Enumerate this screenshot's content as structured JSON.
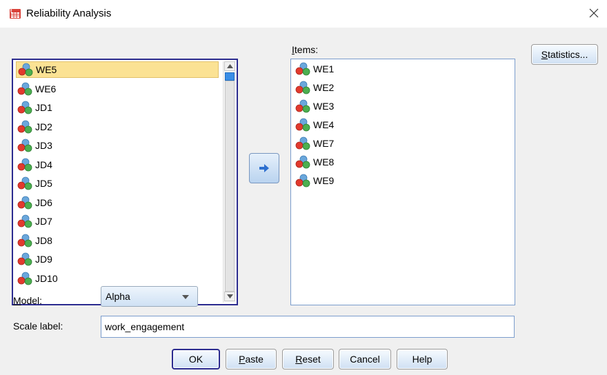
{
  "window": {
    "title": "Reliability Analysis",
    "close_glyph": "×"
  },
  "source_list": {
    "items": [
      {
        "label": "WE5",
        "icon": "scale-variable-icon",
        "selected": true
      },
      {
        "label": "WE6",
        "icon": "scale-variable-icon"
      },
      {
        "label": "JD1",
        "icon": "scale-variable-icon"
      },
      {
        "label": "JD2",
        "icon": "scale-variable-icon"
      },
      {
        "label": "JD3",
        "icon": "scale-variable-icon"
      },
      {
        "label": "JD4",
        "icon": "scale-variable-icon"
      },
      {
        "label": "JD5",
        "icon": "scale-variable-icon"
      },
      {
        "label": "JD6",
        "icon": "scale-variable-icon"
      },
      {
        "label": "JD7",
        "icon": "scale-variable-icon"
      },
      {
        "label": "JD8",
        "icon": "scale-variable-icon"
      },
      {
        "label": "JD9",
        "icon": "scale-variable-icon"
      },
      {
        "label": "JD10",
        "icon": "scale-variable-icon"
      }
    ]
  },
  "items_panel": {
    "label_prefix": "",
    "label_mnemonic": "I",
    "label_rest": "tems:",
    "items": [
      {
        "label": "WE1",
        "icon": "scale-variable-icon"
      },
      {
        "label": "WE2",
        "icon": "scale-variable-icon"
      },
      {
        "label": "WE3",
        "icon": "scale-variable-icon"
      },
      {
        "label": "WE4",
        "icon": "scale-variable-icon"
      },
      {
        "label": "WE7",
        "icon": "scale-variable-icon"
      },
      {
        "label": "WE8",
        "icon": "scale-variable-icon"
      },
      {
        "label": "WE9",
        "icon": "scale-variable-icon"
      }
    ]
  },
  "statistics_button": {
    "mnemonic": "S",
    "rest": "tatistics..."
  },
  "model": {
    "label_mnemonic": "M",
    "label_rest": "odel:",
    "selected": "Alpha"
  },
  "scale_label": {
    "label": "Scale label:",
    "value": "work_engagement"
  },
  "buttons": {
    "ok": "OK",
    "paste": {
      "mnemonic": "P",
      "rest": "aste"
    },
    "reset": {
      "mnemonic": "R",
      "rest": "eset"
    },
    "cancel": "Cancel",
    "help": "Help"
  },
  "colors": {
    "selection": "#fbe294",
    "focus_border": "#2b2b8f",
    "accent_blue": "#3a8ee6"
  }
}
